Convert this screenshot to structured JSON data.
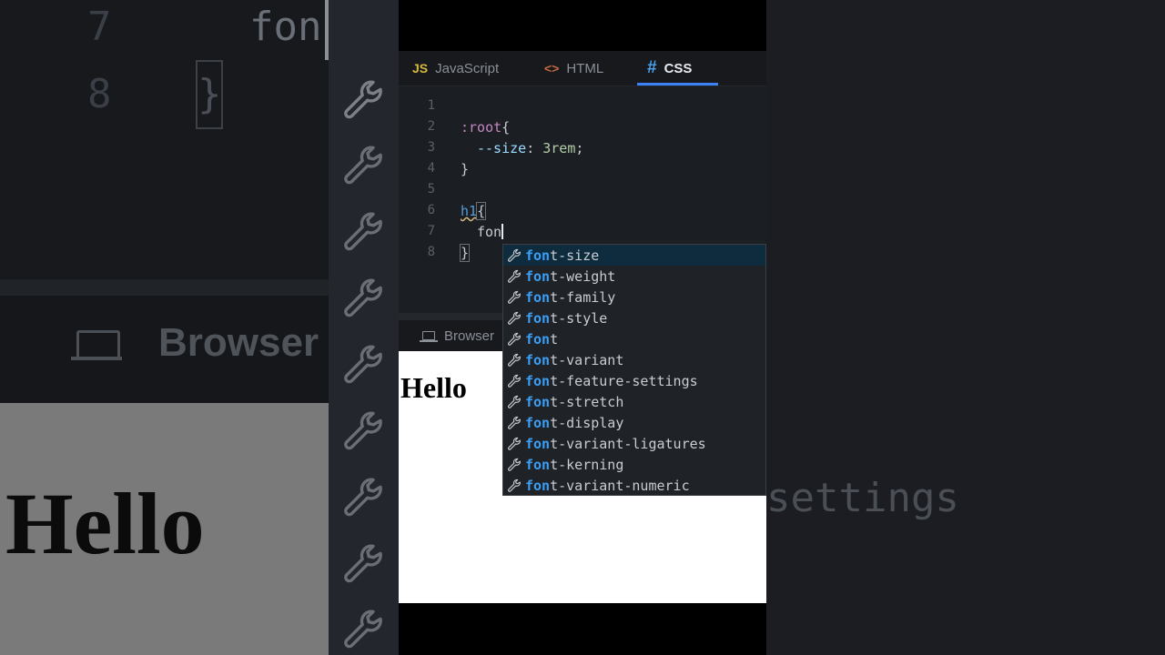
{
  "background": {
    "line_numbers": [
      "7",
      "8"
    ],
    "typed_text": "fon",
    "brace": "}",
    "browser_tab_label": "Browser",
    "preview_text": "Hello",
    "right_text": "settings"
  },
  "tabs": [
    {
      "badge": "JS",
      "label": "JavaScript",
      "active": false
    },
    {
      "badge": "<>",
      "label": "HTML",
      "active": false
    },
    {
      "badge": "#",
      "label": "CSS",
      "active": true
    }
  ],
  "code": {
    "line_numbers": [
      "1",
      "2",
      "3",
      "4",
      "5",
      "6",
      "7",
      "8"
    ],
    "l2_selector": ":root",
    "l2_brace": "{",
    "l3_prop": "--size",
    "l3_colon": ": ",
    "l3_value": "3rem",
    "l3_semi": ";",
    "l4_brace": "}",
    "l6_tag": "h1",
    "l6_brace": "{",
    "l7_typed": "fon",
    "l8_brace": "}"
  },
  "browser_tab": {
    "label": "Browser"
  },
  "preview": {
    "heading": "Hello"
  },
  "autocomplete": {
    "icon": "wrench-icon",
    "match": "fon",
    "items": [
      {
        "rest": "t-size",
        "selected": true
      },
      {
        "rest": "t-weight"
      },
      {
        "rest": "t-family"
      },
      {
        "rest": "t-style"
      },
      {
        "rest": "t"
      },
      {
        "rest": "t-variant"
      },
      {
        "rest": "t-feature-settings"
      },
      {
        "rest": "t-stretch"
      },
      {
        "rest": "t-display"
      },
      {
        "rest": "t-variant-ligatures"
      },
      {
        "rest": "t-kerning"
      },
      {
        "rest": "t-variant-numeric"
      }
    ]
  },
  "colors": {
    "accent": "#3b82f6",
    "match": "#3b9ef5",
    "editor_bg": "#1b1e23"
  }
}
